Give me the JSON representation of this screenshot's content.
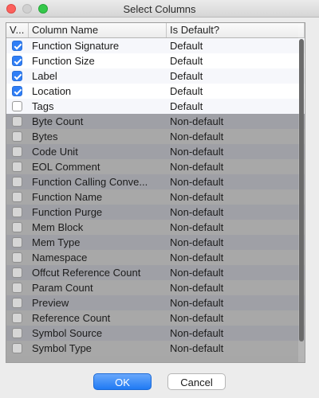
{
  "window": {
    "title": "Select Columns"
  },
  "table": {
    "headers": [
      "V...",
      "Column Name",
      "Is Default?"
    ],
    "rows": [
      {
        "checked": true,
        "name": "Function Signature",
        "status": "Default",
        "kind": "default"
      },
      {
        "checked": true,
        "name": "Function Size",
        "status": "Default",
        "kind": "default"
      },
      {
        "checked": true,
        "name": "Label",
        "status": "Default",
        "kind": "default"
      },
      {
        "checked": true,
        "name": "Location",
        "status": "Default",
        "kind": "default"
      },
      {
        "checked": false,
        "name": "Tags",
        "status": "Default",
        "kind": "default"
      },
      {
        "checked": false,
        "name": "Byte Count",
        "status": "Non-default",
        "kind": "nondef"
      },
      {
        "checked": false,
        "name": "Bytes",
        "status": "Non-default",
        "kind": "nondef"
      },
      {
        "checked": false,
        "name": "Code Unit",
        "status": "Non-default",
        "kind": "nondef"
      },
      {
        "checked": false,
        "name": "EOL Comment",
        "status": "Non-default",
        "kind": "nondef"
      },
      {
        "checked": false,
        "name": "Function Calling Conve...",
        "status": "Non-default",
        "kind": "nondef"
      },
      {
        "checked": false,
        "name": "Function Name",
        "status": "Non-default",
        "kind": "nondef"
      },
      {
        "checked": false,
        "name": "Function Purge",
        "status": "Non-default",
        "kind": "nondef"
      },
      {
        "checked": false,
        "name": "Mem Block",
        "status": "Non-default",
        "kind": "nondef"
      },
      {
        "checked": false,
        "name": "Mem Type",
        "status": "Non-default",
        "kind": "nondef"
      },
      {
        "checked": false,
        "name": "Namespace",
        "status": "Non-default",
        "kind": "nondef"
      },
      {
        "checked": false,
        "name": "Offcut Reference Count",
        "status": "Non-default",
        "kind": "nondef"
      },
      {
        "checked": false,
        "name": "Param Count",
        "status": "Non-default",
        "kind": "nondef"
      },
      {
        "checked": false,
        "name": "Preview",
        "status": "Non-default",
        "kind": "nondef"
      },
      {
        "checked": false,
        "name": "Reference Count",
        "status": "Non-default",
        "kind": "nondef"
      },
      {
        "checked": false,
        "name": "Symbol Source",
        "status": "Non-default",
        "kind": "nondef"
      },
      {
        "checked": false,
        "name": "Symbol Type",
        "status": "Non-default",
        "kind": "nondef"
      }
    ]
  },
  "buttons": {
    "ok": "OK",
    "cancel": "Cancel"
  },
  "colors": {
    "accent": "#2f7ef6",
    "close": "#fc605c",
    "maximize": "#34c84a"
  }
}
